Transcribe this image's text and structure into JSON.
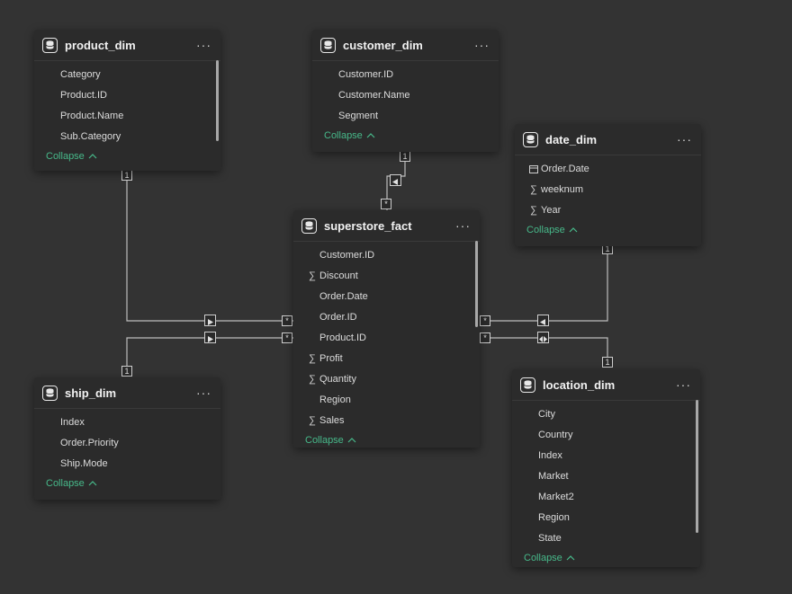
{
  "ui": {
    "more_label": "···",
    "collapse_label": "Collapse",
    "chevron_glyph": "^"
  },
  "tables": {
    "product_dim": {
      "title": "product_dim",
      "fields": [
        {
          "name": "Category",
          "icon": ""
        },
        {
          "name": "Product.ID",
          "icon": ""
        },
        {
          "name": "Product.Name",
          "icon": ""
        },
        {
          "name": "Sub.Category",
          "icon": ""
        }
      ]
    },
    "customer_dim": {
      "title": "customer_dim",
      "fields": [
        {
          "name": "Customer.ID",
          "icon": ""
        },
        {
          "name": "Customer.Name",
          "icon": ""
        },
        {
          "name": "Segment",
          "icon": ""
        }
      ]
    },
    "date_dim": {
      "title": "date_dim",
      "fields": [
        {
          "name": "Order.Date",
          "icon": "calendar-icon"
        },
        {
          "name": "weeknum",
          "icon": "sigma-icon"
        },
        {
          "name": "Year",
          "icon": "sigma-icon"
        }
      ]
    },
    "superstore_fact": {
      "title": "superstore_fact",
      "fields": [
        {
          "name": "Customer.ID",
          "icon": ""
        },
        {
          "name": "Discount",
          "icon": "sigma-icon"
        },
        {
          "name": "Order.Date",
          "icon": ""
        },
        {
          "name": "Order.ID",
          "icon": ""
        },
        {
          "name": "Product.ID",
          "icon": ""
        },
        {
          "name": "Profit",
          "icon": "sigma-icon"
        },
        {
          "name": "Quantity",
          "icon": "sigma-icon"
        },
        {
          "name": "Region",
          "icon": ""
        },
        {
          "name": "Sales",
          "icon": "sigma-icon"
        }
      ]
    },
    "ship_dim": {
      "title": "ship_dim",
      "fields": [
        {
          "name": "Index",
          "icon": ""
        },
        {
          "name": "Order.Priority",
          "icon": ""
        },
        {
          "name": "Ship.Mode",
          "icon": ""
        }
      ]
    },
    "location_dim": {
      "title": "location_dim",
      "fields": [
        {
          "name": "City",
          "icon": ""
        },
        {
          "name": "Country",
          "icon": ""
        },
        {
          "name": "Index",
          "icon": ""
        },
        {
          "name": "Market",
          "icon": ""
        },
        {
          "name": "Market2",
          "icon": ""
        },
        {
          "name": "Region",
          "icon": ""
        },
        {
          "name": "State",
          "icon": ""
        }
      ]
    }
  },
  "relationships": [
    {
      "name": "product-to-fact",
      "from": "product_dim",
      "to": "superstore_fact",
      "one_label": "1",
      "many_label": "*",
      "filter_direction": "single"
    },
    {
      "name": "ship-to-fact",
      "from": "ship_dim",
      "to": "superstore_fact",
      "one_label": "1",
      "many_label": "*",
      "filter_direction": "single"
    },
    {
      "name": "customer-to-fact",
      "from": "customer_dim",
      "to": "superstore_fact",
      "one_label": "1",
      "many_label": "*",
      "filter_direction": "single"
    },
    {
      "name": "date-to-fact",
      "from": "date_dim",
      "to": "superstore_fact",
      "one_label": "1",
      "many_label": "*",
      "filter_direction": "single"
    },
    {
      "name": "location-to-fact",
      "from": "location_dim",
      "to": "superstore_fact",
      "one_label": "1",
      "many_label": "*",
      "filter_direction": "both"
    }
  ],
  "colors": {
    "background": "#333333",
    "card": "#2b2b2b",
    "accent": "#47b98a",
    "line": "#bdbdbd"
  }
}
